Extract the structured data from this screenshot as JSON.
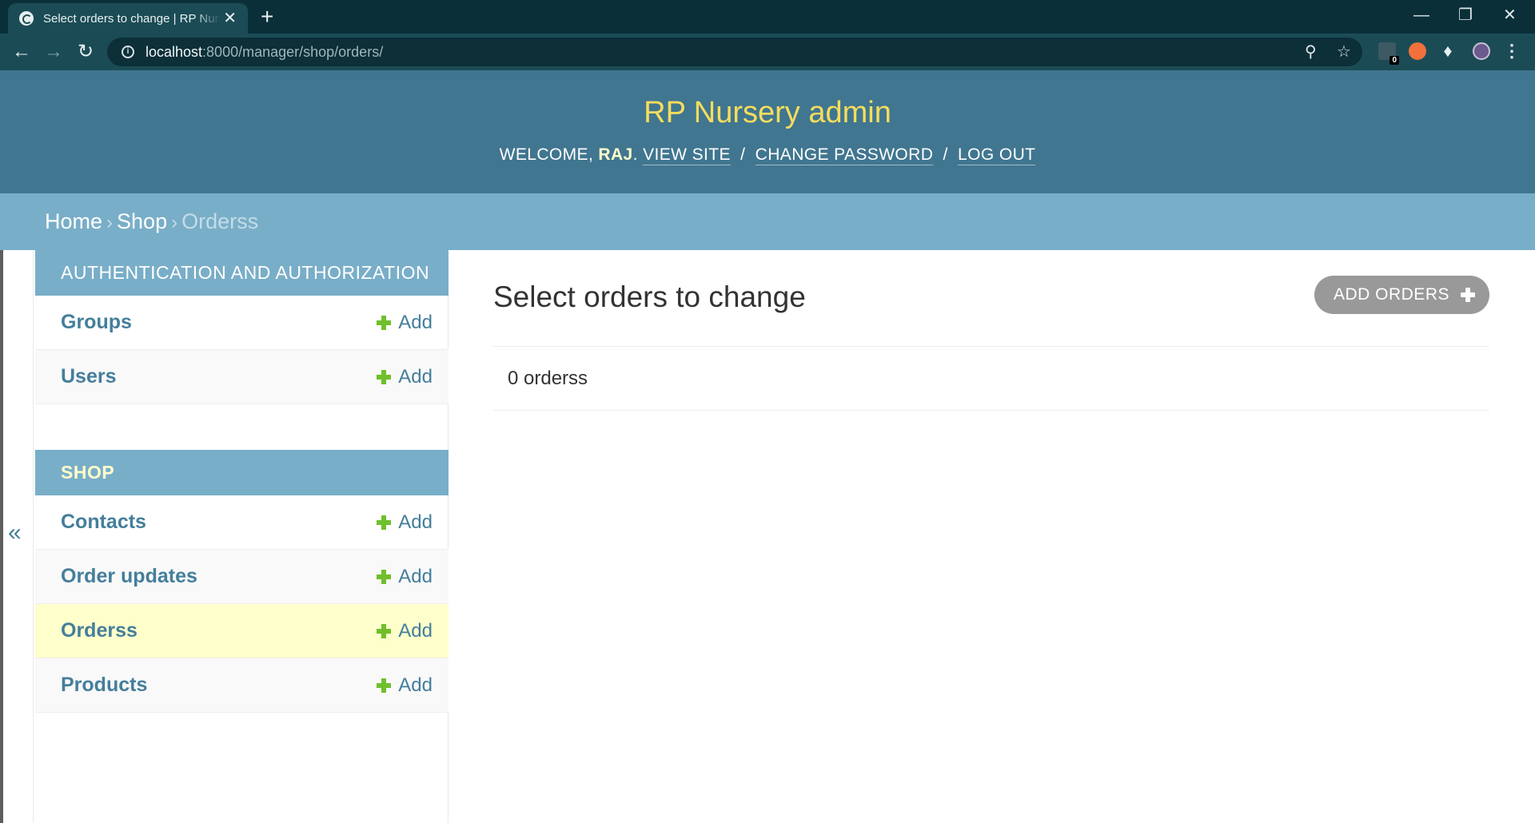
{
  "browser": {
    "tab_title": "Select orders to change | RP Nursery admin",
    "tab_close": "✕",
    "new_tab": "+",
    "url_host": "localhost",
    "url_path": ":8000/manager/shop/orders/",
    "ext_badge": "0"
  },
  "header": {
    "site_name": "RP Nursery admin",
    "welcome": "WELCOME, ",
    "username": "RAJ",
    "view_site": "VIEW SITE",
    "change_password": "CHANGE PASSWORD",
    "log_out": "LOG OUT",
    "separator": "/"
  },
  "breadcrumbs": [
    "Home",
    "Shop",
    "Orderss"
  ],
  "breadcrumb_arrow": "›",
  "nav_toggle": "«",
  "sidebar": {
    "modules": [
      {
        "caption": "AUTHENTICATION AND AUTHORIZATION",
        "models": [
          {
            "name": "Groups",
            "add": "Add"
          },
          {
            "name": "Users",
            "add": "Add"
          }
        ]
      },
      {
        "caption": "SHOP",
        "models": [
          {
            "name": "Contacts",
            "add": "Add"
          },
          {
            "name": "Order updates",
            "add": "Add"
          },
          {
            "name": "Orderss",
            "add": "Add",
            "current": true
          },
          {
            "name": "Products",
            "add": "Add"
          }
        ]
      }
    ]
  },
  "content": {
    "title": "Select orders to change",
    "add_button": "ADD ORDERS",
    "result_count": "0 orderss"
  },
  "colors": {
    "header_bg": "#417690",
    "site_name": "#f5dd5d",
    "breadcrumbs_bg": "#79aec8",
    "link": "#447e9b",
    "add_icon": "#70bf2b",
    "current_row": "#ffffcc"
  }
}
